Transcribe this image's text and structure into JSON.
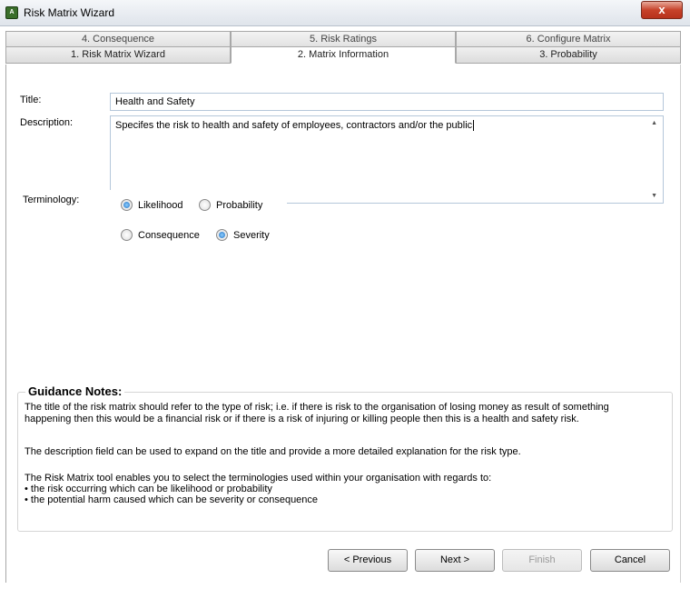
{
  "window": {
    "title": "Risk Matrix Wizard",
    "close_glyph": "x"
  },
  "tabs": {
    "row1": [
      "4. Consequence",
      "5. Risk Ratings",
      "6. Configure Matrix"
    ],
    "row2": [
      "1. Risk Matrix Wizard",
      "2. Matrix Information",
      "3. Probability"
    ],
    "active": "2. Matrix Information"
  },
  "form": {
    "title_label": "Title:",
    "title_value": "Health and Safety",
    "description_label": "Description:",
    "description_value": "Specifes the risk to health and safety of employees, contractors and/or the public",
    "terminology_label": "Terminology:",
    "options": {
      "likelihood": {
        "label": "Likelihood",
        "checked": true
      },
      "probability": {
        "label": "Probability",
        "checked": false
      },
      "consequence": {
        "label": "Consequence",
        "checked": false
      },
      "severity": {
        "label": "Severity",
        "checked": true
      }
    }
  },
  "guidance": {
    "heading": "Guidance Notes:",
    "p1_line1": "The title of the risk matrix should refer to the type of risk; i.e. if there is risk to the organisation of losing money as result of something",
    "p1_line2": "happening then this would be a financial risk or if there is a risk of injuring or killing people then this is a health and safety risk.",
    "p2": "The description field can be used to expand on the title and provide a more detailed explanation for the risk type.",
    "p3_line1": "The Risk Matrix tool enables you to select the terminologies used within your organisation with regards to:",
    "p3_bullet1": "• the risk occurring which can be likelihood or probability",
    "p3_bullet2": "• the potential harm caused which can be severity or consequence"
  },
  "buttons": {
    "previous": "< Previous",
    "next": "Next >",
    "finish": "Finish",
    "cancel": "Cancel"
  },
  "icons": {
    "app": "risk-matrix-app-icon",
    "close": "close-icon"
  }
}
